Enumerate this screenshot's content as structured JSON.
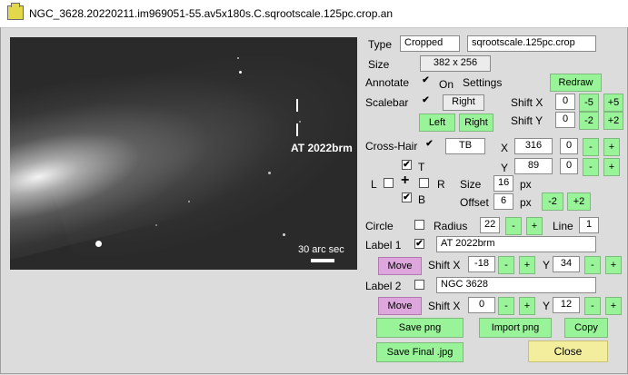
{
  "window": {
    "title": "NGC_3628.20220211.im969051-55.av5x180s.C.sqrootscale.125pc.crop.an"
  },
  "image": {
    "target_label": "AT 2022brm",
    "scalebar_label": "30 arc sec"
  },
  "type_row": {
    "label": "Type",
    "value1": "Cropped",
    "value2": "sqrootscale.125pc.crop"
  },
  "size_row": {
    "label": "Size",
    "value": "382 x 256"
  },
  "annotate": {
    "label": "Annotate",
    "checked": "✔",
    "on_label": "On",
    "settings_label": "Settings",
    "redraw": "Redraw"
  },
  "scalebar": {
    "label": "Scalebar",
    "checked": "✔",
    "position": "Right",
    "left_btn": "Left",
    "right_btn": "Right",
    "shiftx_label": "Shift X",
    "shiftx_value": "0",
    "shifty_label": "Shift Y",
    "shifty_value": "0",
    "minus5": "-5",
    "plus5": "+5",
    "minus2": "-2",
    "plus2": "+2"
  },
  "crosshair": {
    "label": "Cross-Hair",
    "checked": "✔",
    "mode": "TB",
    "x_label": "X",
    "x_value": "316",
    "x_offset": "0",
    "y_label": "Y",
    "y_value": "89",
    "y_offset": "0",
    "minus": "-",
    "plus": "+",
    "t_label": "T",
    "t_checked": "✔",
    "b_label": "B",
    "b_checked": "✔",
    "l_label": "L",
    "r_label": "R",
    "center_symbol": "+",
    "size_label": "Size",
    "size_value": "16",
    "size_unit": "px",
    "offset_label": "Offset",
    "offset_value": "6",
    "offset_unit": "px",
    "offset_minus": "-2",
    "offset_plus": "+2"
  },
  "circle": {
    "label": "Circle",
    "radius_label": "Radius",
    "radius_value": "22",
    "minus": "-",
    "plus": "+",
    "line_label": "Line",
    "line_value": "1"
  },
  "label1": {
    "label": "Label 1",
    "checked": "✔",
    "value": "AT 2022brm",
    "move": "Move",
    "shiftx_label": "Shift X",
    "shiftx_value": "-18",
    "y_label": "Y",
    "y_value": "34",
    "minus": "-",
    "plus": "+"
  },
  "label2": {
    "label": "Label 2",
    "value": "NGC 3628",
    "move": "Move",
    "shiftx_label": "Shift X",
    "shiftx_value": "0",
    "y_label": "Y",
    "y_value": "12",
    "minus": "-",
    "plus": "+"
  },
  "actions": {
    "save_png": "Save png",
    "import_png": "Import png",
    "copy": "Copy",
    "save_final": "Save Final .jpg",
    "close": "Close"
  }
}
